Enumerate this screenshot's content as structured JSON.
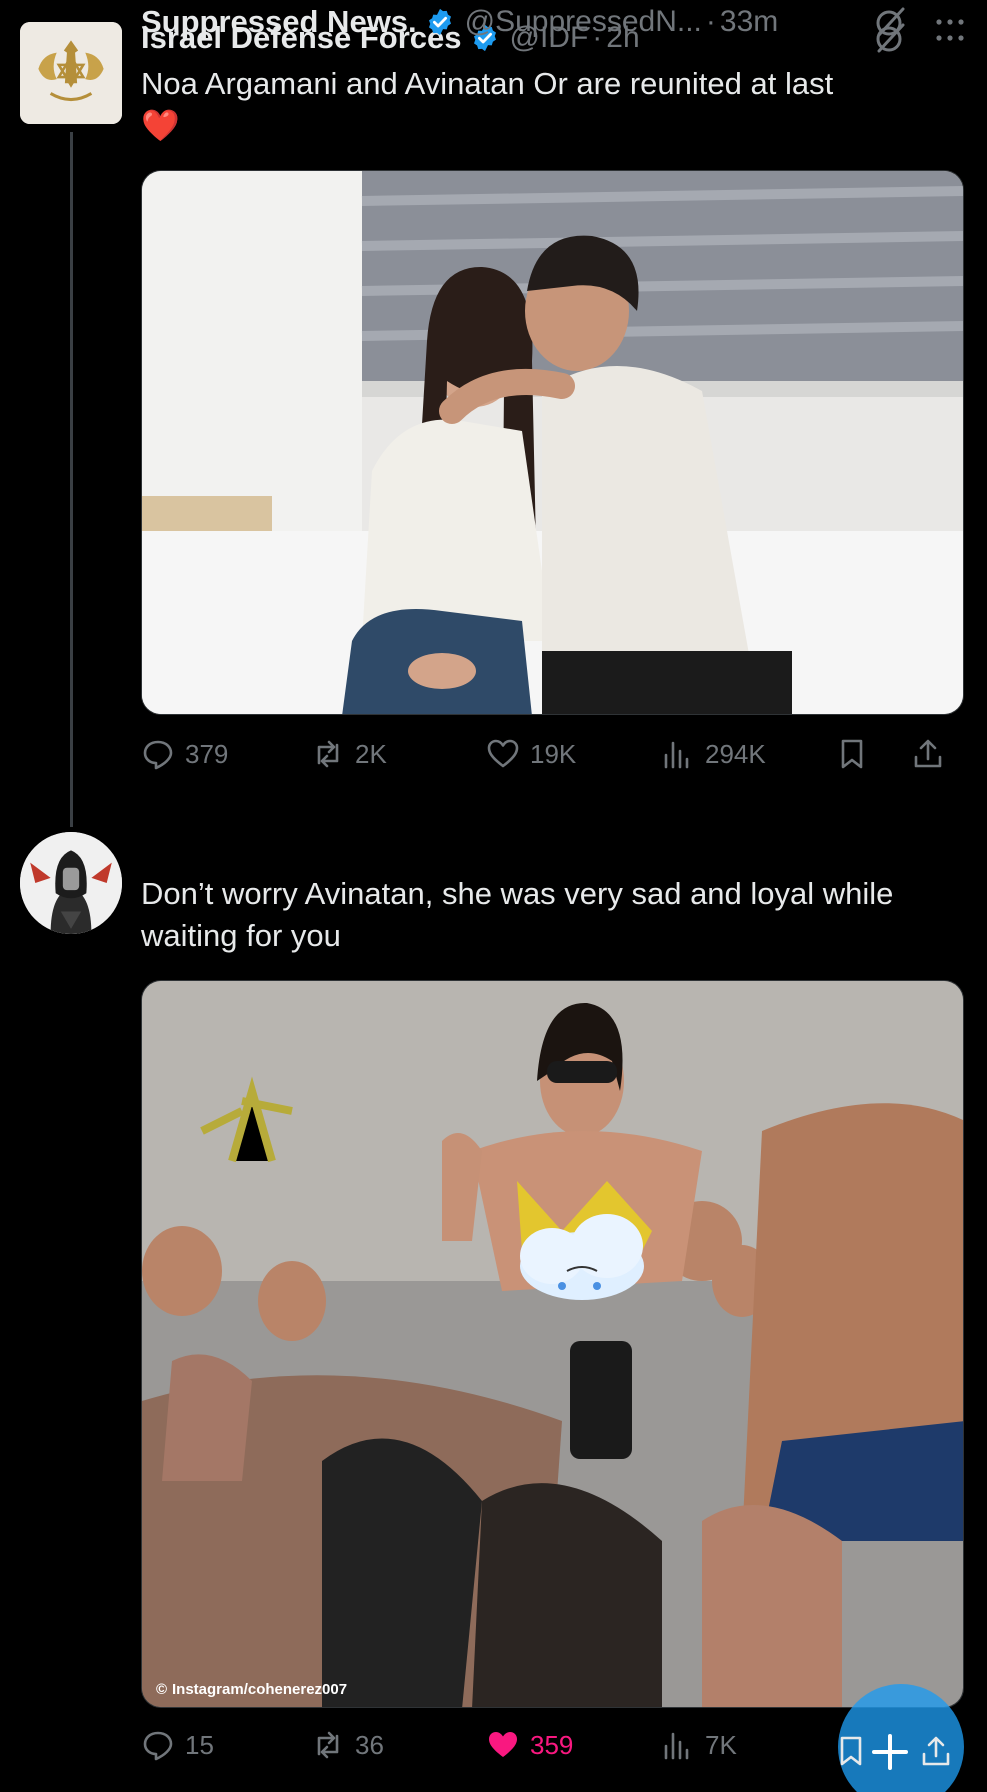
{
  "tweets": [
    {
      "author_name": "Israel Defense Forces",
      "handle": "@IDF",
      "sep": "·",
      "time": "2h",
      "text": "Noa Argamani and Avinatan Or are reunited at last",
      "emoji": "❤️",
      "media_description": "",
      "stats": {
        "replies": "379",
        "reposts": "2K",
        "likes": "19K",
        "views": "294K"
      },
      "liked": false
    },
    {
      "author_name": "Suppressed News.",
      "handle": "@SuppressedN...",
      "sep": "·",
      "time": "33m",
      "text": "Don’t worry Avinatan, she was very sad and loyal while waiting for you",
      "media_watermark": "Instagram/cohenerez007",
      "stats": {
        "replies": "15",
        "reposts": "36",
        "likes": "359",
        "views": "7K"
      },
      "liked": true
    }
  ],
  "colors": {
    "background": "#000000",
    "text": "#e7e9ea",
    "secondary": "#71767b",
    "verified": "#1d9bf0",
    "like": "#f91880",
    "fab": "#1d9bf0"
  },
  "icons": {
    "reply": "reply-icon",
    "repost": "repost-icon",
    "like": "heart-icon",
    "views": "views-icon",
    "bookmark": "bookmark-icon",
    "share": "share-icon",
    "grok": "grok-icon",
    "more": "more-icon",
    "verified": "verified-badge-icon",
    "fab": "compose-plus-icon"
  }
}
